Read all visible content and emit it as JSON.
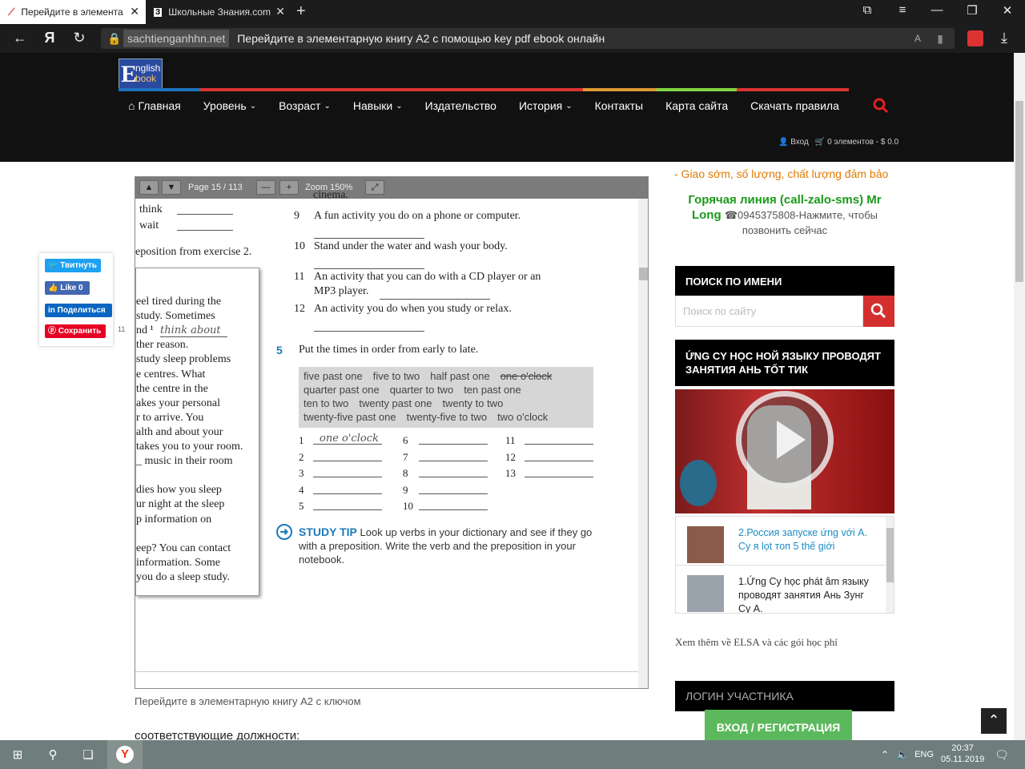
{
  "browser": {
    "tabs": [
      {
        "title": "Перейдите в элементар"
      },
      {
        "title": "Школьные Знания.com - Р"
      }
    ],
    "url_domain": "sachtienganhhn.net",
    "url_title": "Перейдите в элементарную книгу A2 с помощью key pdf ebook онлайн",
    "back_icon": "arrow-left-icon",
    "yandex_icon": "Я"
  },
  "site": {
    "logo": {
      "big": "E",
      "line1": "nglish",
      "line2": "book"
    },
    "menu": [
      {
        "label": "Главная",
        "dropdown": false
      },
      {
        "label": "Уровень",
        "dropdown": true
      },
      {
        "label": "Возраст",
        "dropdown": true
      },
      {
        "label": "Навыки",
        "dropdown": true
      },
      {
        "label": "Издательство",
        "dropdown": false
      },
      {
        "label": "История",
        "dropdown": true
      },
      {
        "label": "Контакты",
        "dropdown": false
      },
      {
        "label": "Карта сайта",
        "dropdown": false
      },
      {
        "label": "Скачать правила",
        "dropdown": false
      }
    ],
    "menu_colors": [
      "#1e73be",
      "#dd3333",
      "#dd3333",
      "#dd3333",
      "#dd3333",
      "#dd3333",
      "#dd9933",
      "#81d742",
      "#dd3333"
    ],
    "login": "Вход",
    "cart": "0 элементов - $ 0.0"
  },
  "viewer": {
    "page_label": "Page 15 / 113",
    "zoom_label": "Zoom 150%",
    "left_words": [
      "think",
      "wait"
    ],
    "left_heading": "eposition from exercise 2.",
    "left_page_lines": [
      "eel tired during the",
      "study. Sometimes",
      "nd ¹",
      "ther reason.",
      "study sleep problems",
      "e centres. What",
      " the centre in the",
      "akes your personal",
      "r to arrive. You",
      "alth and about your",
      "takes you to your room.",
      "_ music in their room",
      "",
      "dies how you sleep",
      "ur night at the sleep",
      "p information on",
      "",
      "eep? You can contact",
      " information. Some",
      "you do a sleep study."
    ],
    "handwritten_1": "think about",
    "cut_top": "cinema.",
    "items": [
      {
        "num": "9",
        "text": "A fun activity you do on a phone or computer."
      },
      {
        "num": "10",
        "text": "Stand under the water and wash your body."
      },
      {
        "num": "11",
        "text": "An activity that you can do with a CD player or an"
      },
      {
        "num": "",
        "text": "MP3 player."
      },
      {
        "num": "12",
        "text": "An activity you do when you study or relax."
      }
    ],
    "ex5_num": "5",
    "ex5_text": "Put the times in order from early to late.",
    "word_box": [
      [
        "five past one",
        "five to two",
        "half past one",
        "one o'clock"
      ],
      [
        "quarter past one",
        "quarter to two",
        "ten past one"
      ],
      [
        "ten to two",
        "twenty past one",
        "twenty to two"
      ],
      [
        "twenty-five past one",
        "twenty-five to two",
        "two o'clock"
      ]
    ],
    "answer_nums": [
      "1",
      "2",
      "3",
      "4",
      "5",
      "6",
      "7",
      "8",
      "9",
      "10",
      "11",
      "12",
      "13"
    ],
    "answer_1": "one o'clock",
    "study_tip_label": "STUDY TIP",
    "study_tip_text": "Look up verbs in your dictionary and see if they go with a preposition. Write the verb and the preposition in your notebook.",
    "side_number": "11"
  },
  "caption": "Перейдите в элементарную книгу A2 с ключом",
  "truncated_text": "соответствующие должности:",
  "share": {
    "twitter": "Твитнуть",
    "facebook": "Like 0",
    "linkedin": "Поделиться",
    "pinterest": "Сохранить"
  },
  "sidebar": {
    "promo": "- Giao sớm, số lượng, chất lượng đảm bảo",
    "hotline_title": "Горячая линия (call-zalo-sms) Mr Long",
    "hotline_phone": "☎0945375808-Нажмите, чтобы позвонить сейчас",
    "search_heading": "ПОИСК ПО ИМЕНИ",
    "search_placeholder": "Поиск по сайту",
    "video_heading": "ỨNG CY HỌC НОЙ ЯЗЫКУ ПРОВОДЯТ ЗАНЯТИЯ АНЬ ТỐТ ТИК",
    "playlist": [
      "2.Россия запуске ứng với А. Су я lọt топ 5 thế giới",
      "1.Ứng Су học phát âm языку проводят занятия Ань Зунг Су А."
    ],
    "more_link": "Xem thêm về ELSA và các gói học phí",
    "login_heading": "ЛОГИН УЧАСТНИКА",
    "register_button": "ВХОД / РЕГИСТРАЦИЯ"
  },
  "taskbar": {
    "lang": "ENG",
    "time": "20:37",
    "date": "05.11.2019"
  }
}
